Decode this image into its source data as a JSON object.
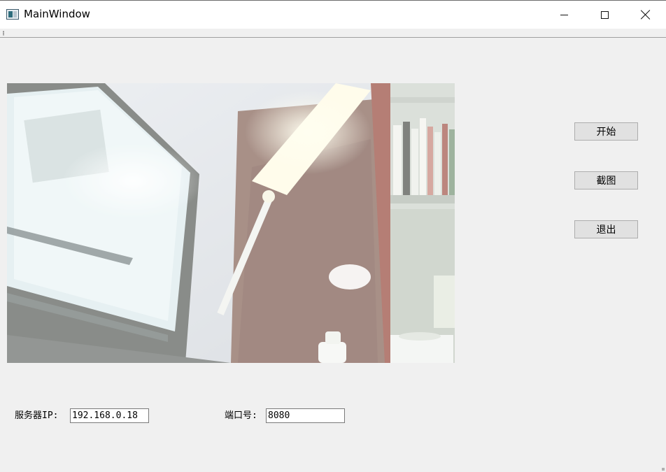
{
  "window": {
    "title": "MainWindow"
  },
  "video": {
    "description_icon": "camera-feed"
  },
  "buttons": {
    "start": "开始",
    "capture": "截图",
    "exit": "退出"
  },
  "form": {
    "ip_label": "服务器IP:",
    "ip_value": "192.168.0.18",
    "port_label": "端口号:",
    "port_value": "8080"
  },
  "colors": {
    "background": "#f0f0f0",
    "button_face": "#e1e1e1",
    "button_border": "#adadad"
  }
}
